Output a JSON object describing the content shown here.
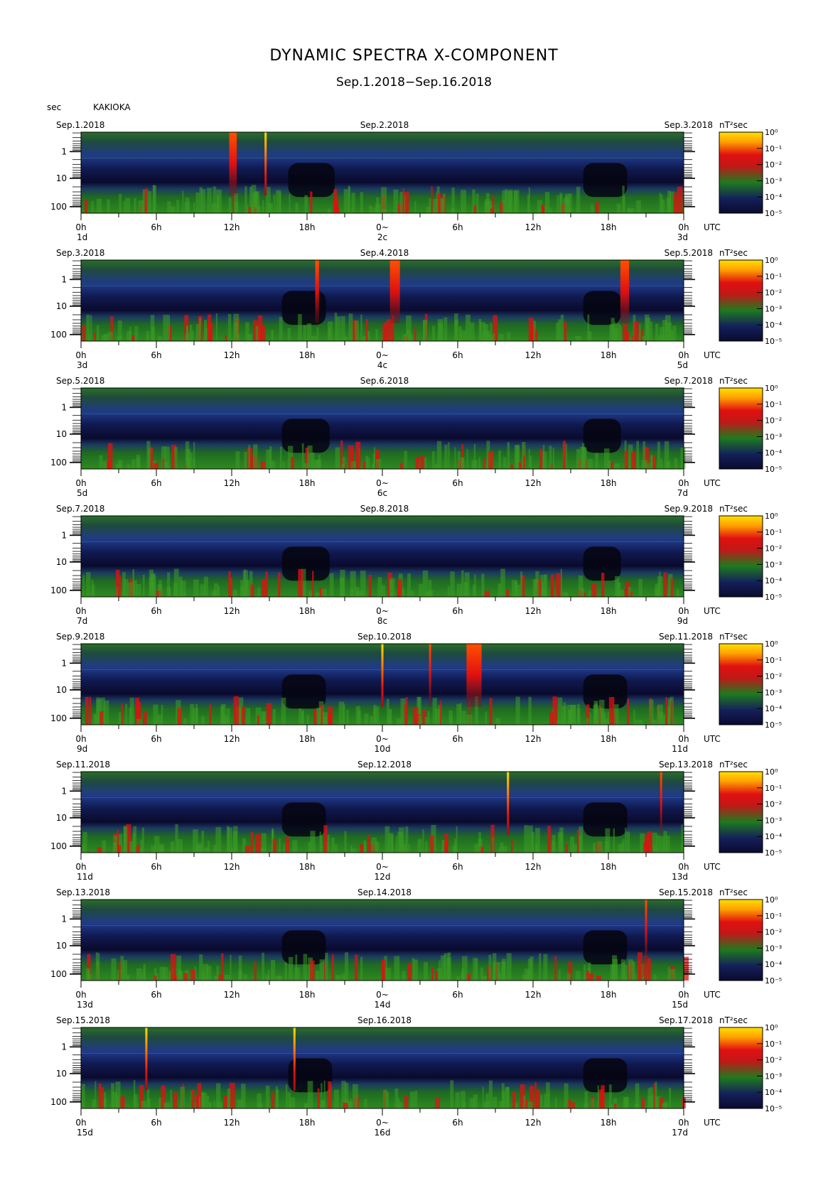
{
  "title": "DYNAMIC SPECTRA X-COMPONENT",
  "subtitle": "Sep.1.2018−Sep.16.2018",
  "unit_label": "sec",
  "station": "KAKIOKA",
  "colors": {
    "low": "#0a0a2e",
    "mid_low": "#203a8a",
    "mid": "#1f7a1f",
    "high": "#e01010",
    "max": "#ffe000"
  },
  "chart_data": {
    "type": "heatmap",
    "quantity": "Power spectral density of X-component",
    "y_axis": {
      "label": "sec",
      "scale": "log",
      "ticks": [
        "1",
        "10",
        "100"
      ]
    },
    "x_axis": {
      "ticks": [
        "0h",
        "6h",
        "12h",
        "18h",
        "0~",
        "6h",
        "12h",
        "18h",
        "0h"
      ],
      "utc_label": "UTC"
    },
    "colorbar": {
      "unit": "nT²sec",
      "ticks": [
        "10⁰",
        "10⁻¹",
        "10⁻²",
        "10⁻³",
        "10⁻⁴",
        "10⁻⁵"
      ]
    },
    "panels": [
      {
        "date_left": "Sep.1.2018",
        "date_mid": "Sep.2.2018",
        "date_right": "Sep.3.2018",
        "day_left": "1d",
        "day_mid": "2c",
        "day_right": "3d",
        "spikes": [
          {
            "h": 12.1,
            "w": 0.6
          },
          {
            "h": 14.7,
            "w": 0.15,
            "bright": true
          }
        ],
        "quiet": [
          [
            16.5,
            20.2
          ],
          [
            40.0,
            43.5
          ]
        ]
      },
      {
        "date_left": "Sep.3.2018",
        "date_mid": "Sep.4.2018",
        "date_right": "Sep.5.2018",
        "day_left": "3d",
        "day_mid": "4c",
        "day_right": "5d",
        "spikes": [
          {
            "h": 18.8,
            "w": 0.3
          },
          {
            "h": 25.0,
            "w": 0.8
          },
          {
            "h": 43.3,
            "w": 0.7
          }
        ],
        "quiet": [
          [
            16.0,
            19.5
          ],
          [
            40.0,
            43.0
          ]
        ]
      },
      {
        "date_left": "Sep.5.2018",
        "date_mid": "Sep.6.2018",
        "date_right": "Sep.7.2018",
        "day_left": "5d",
        "day_mid": "6c",
        "day_right": "7d",
        "spikes": [],
        "quiet": [
          [
            16.0,
            19.8
          ],
          [
            40.0,
            43.0
          ]
        ]
      },
      {
        "date_left": "Sep.7.2018",
        "date_mid": "Sep.8.2018",
        "date_right": "Sep.9.2018",
        "day_left": "7d",
        "day_mid": "8c",
        "day_right": "9d",
        "spikes": [],
        "quiet": [
          [
            16.0,
            19.8
          ],
          [
            40.0,
            43.0
          ]
        ]
      },
      {
        "date_left": "Sep.9.2018",
        "date_mid": "Sep.10.2018",
        "date_right": "Sep.11.2018",
        "day_left": "9d",
        "day_mid": "10d",
        "day_right": "11d",
        "spikes": [
          {
            "h": 24.0,
            "w": 0.15,
            "bright": true
          },
          {
            "h": 27.8,
            "w": 0.15
          },
          {
            "h": 31.3,
            "w": 1.2
          }
        ],
        "quiet": [
          [
            16.0,
            19.5
          ],
          [
            40.0,
            43.5
          ]
        ]
      },
      {
        "date_left": "Sep.11.2018",
        "date_mid": "Sep.12.2018",
        "date_right": "Sep.13.2018",
        "day_left": "11d",
        "day_mid": "12d",
        "day_right": "13d",
        "spikes": [
          {
            "h": 34.0,
            "w": 0.15,
            "bright": true
          },
          {
            "h": 46.2,
            "w": 0.15
          }
        ],
        "quiet": [
          [
            16.0,
            19.5
          ],
          [
            40.0,
            43.5
          ]
        ]
      },
      {
        "date_left": "Sep.13.2018",
        "date_mid": "Sep.14.2018",
        "date_right": "Sep.15.2018",
        "day_left": "13d",
        "day_mid": "14d",
        "day_right": "15d",
        "spikes": [
          {
            "h": 45.0,
            "w": 0.15
          }
        ],
        "quiet": [
          [
            16.0,
            19.5
          ],
          [
            40.0,
            43.5
          ]
        ]
      },
      {
        "date_left": "Sep.15.2018",
        "date_mid": "Sep.16.2018",
        "date_right": "Sep.17.2018",
        "day_left": "15d",
        "day_mid": "16d",
        "day_right": "17d",
        "spikes": [
          {
            "h": 5.2,
            "w": 0.15,
            "bright": true
          },
          {
            "h": 17.0,
            "w": 0.15,
            "bright": true
          }
        ],
        "quiet": [
          [
            16.5,
            20.0
          ],
          [
            40.0,
            43.5
          ]
        ]
      }
    ]
  }
}
